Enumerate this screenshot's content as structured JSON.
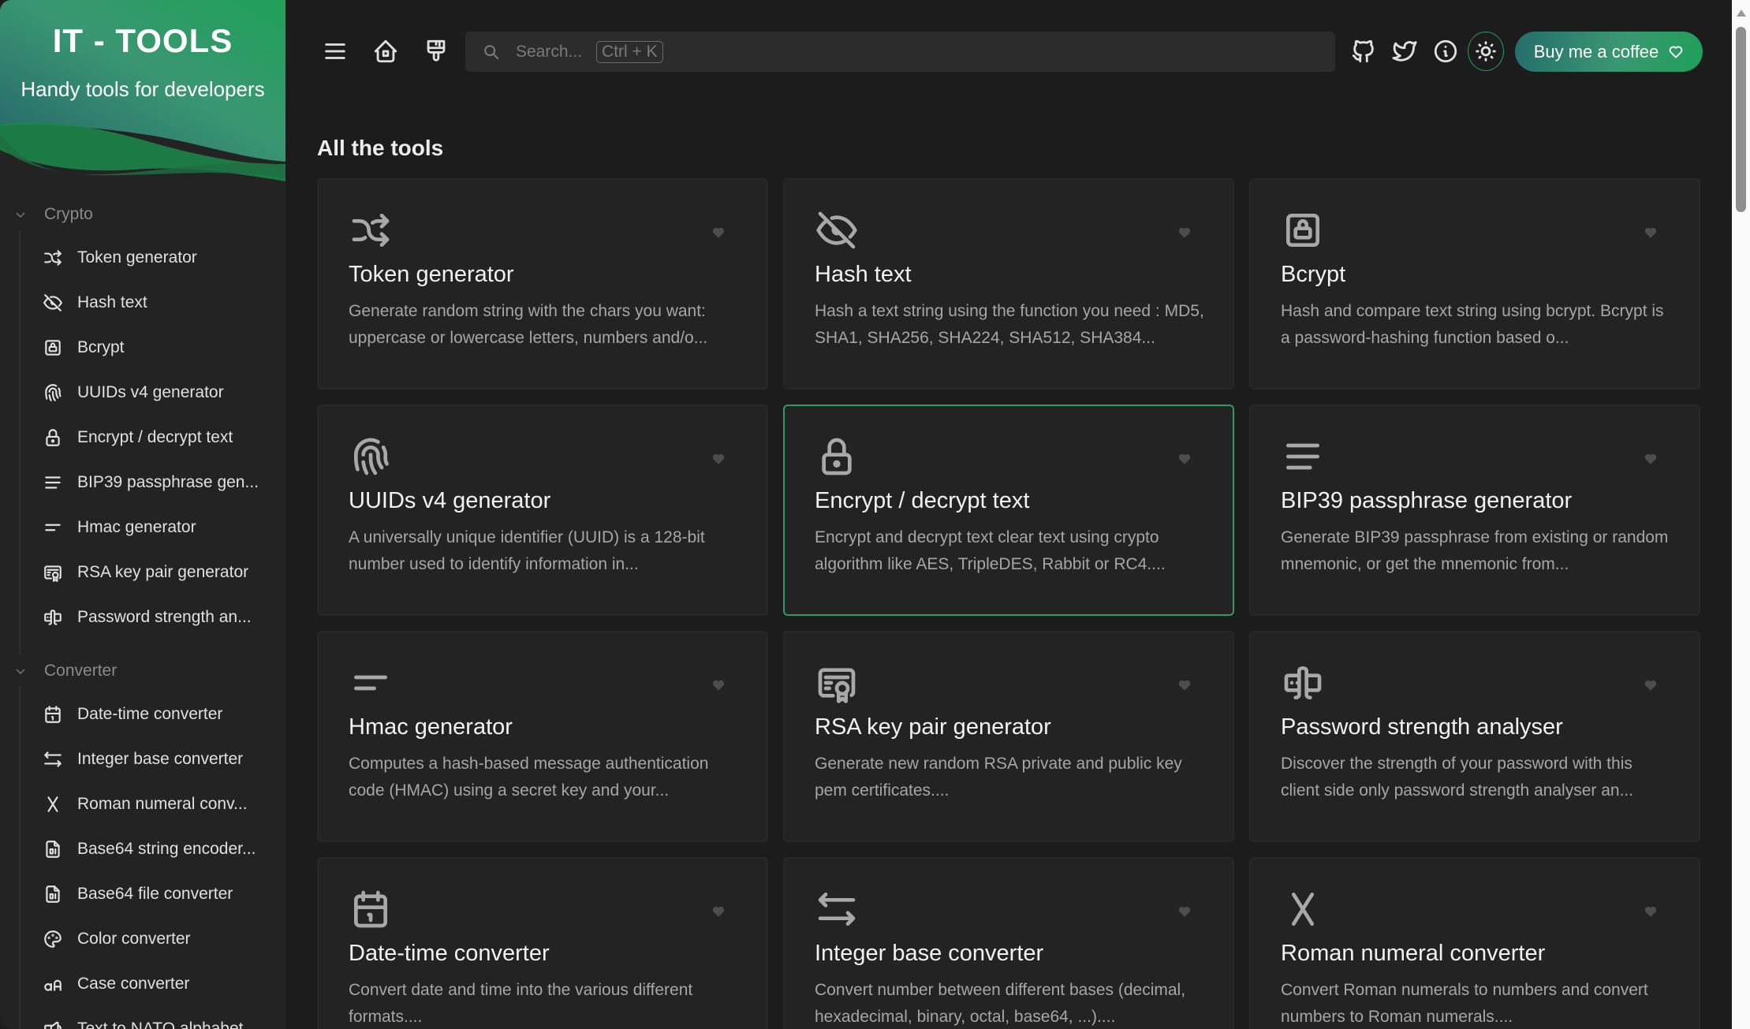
{
  "brand": {
    "title": "IT - TOOLS",
    "subtitle": "Handy tools for developers",
    "gradient_colors": [
      "#25636b",
      "#3a9772",
      "#1fa058"
    ]
  },
  "sidebar": {
    "groups": [
      {
        "label": "Crypto",
        "expanded": true,
        "items": [
          {
            "label": "Token generator",
            "icon": "shuffle-icon"
          },
          {
            "label": "Hash text",
            "icon": "eye-off-icon"
          },
          {
            "label": "Bcrypt",
            "icon": "lock-square-icon"
          },
          {
            "label": "UUIDs v4 generator",
            "icon": "fingerprint-icon"
          },
          {
            "label": "Encrypt / decrypt text",
            "icon": "lock-icon"
          },
          {
            "label": "BIP39 passphrase gen...",
            "icon": "align-justified-icon"
          },
          {
            "label": "Hmac generator",
            "icon": "short-text-icon"
          },
          {
            "label": "RSA key pair generator",
            "icon": "certificate-icon"
          },
          {
            "label": "Password strength an...",
            "icon": "password-field-icon"
          }
        ]
      },
      {
        "label": "Converter",
        "expanded": true,
        "items": [
          {
            "label": "Date-time converter",
            "icon": "calendar-icon"
          },
          {
            "label": "Integer base converter",
            "icon": "arrows-left-right-icon"
          },
          {
            "label": "Roman numeral conv...",
            "icon": "letter-x-icon"
          },
          {
            "label": "Base64 string encoder...",
            "icon": "file-binary-icon"
          },
          {
            "label": "Base64 file converter",
            "icon": "file-binary-icon"
          },
          {
            "label": "Color converter",
            "icon": "palette-icon"
          },
          {
            "label": "Case converter",
            "icon": "letter-case-icon"
          },
          {
            "label": "Text to NATO alphabet",
            "icon": "speakerphone-icon"
          }
        ]
      }
    ]
  },
  "topbar": {
    "search_placeholder": "Search...",
    "search_shortcut": "Ctrl + K",
    "coffee_label": "Buy me a coffee",
    "accent": "#1f9d55"
  },
  "main": {
    "heading": "All the tools",
    "tools": [
      {
        "title": "Token generator",
        "description": "Generate random string with the chars you want: uppercase or lowercase letters, numbers and/o...",
        "icon": "shuffle-icon",
        "active": false
      },
      {
        "title": "Hash text",
        "description": "Hash a text string using the function you need : MD5, SHA1, SHA256, SHA224, SHA512, SHA384...",
        "icon": "eye-off-icon",
        "active": false
      },
      {
        "title": "Bcrypt",
        "description": "Hash and compare text string using bcrypt. Bcrypt is a password-hashing function based o...",
        "icon": "lock-square-icon",
        "active": false
      },
      {
        "title": "UUIDs v4 generator",
        "description": "A universally unique identifier (UUID) is a 128-bit number used to identify information in...",
        "icon": "fingerprint-icon",
        "active": false
      },
      {
        "title": "Encrypt / decrypt text",
        "description": "Encrypt and decrypt text clear text using crypto algorithm like AES, TripleDES, Rabbit or RC4....",
        "icon": "lock-icon",
        "active": true
      },
      {
        "title": "BIP39 passphrase generator",
        "description": "Generate BIP39 passphrase from existing or random mnemonic, or get the mnemonic from...",
        "icon": "align-justified-icon",
        "active": false
      },
      {
        "title": "Hmac generator",
        "description": "Computes a hash-based message authentication code (HMAC) using a secret key and your...",
        "icon": "short-text-icon",
        "active": false
      },
      {
        "title": "RSA key pair generator",
        "description": "Generate new random RSA private and public key pem certificates....",
        "icon": "certificate-icon",
        "active": false
      },
      {
        "title": "Password strength analyser",
        "description": "Discover the strength of your password with this client side only password strength analyser an...",
        "icon": "password-field-icon",
        "active": false
      },
      {
        "title": "Date-time converter",
        "description": "Convert date and time into the various different formats....",
        "icon": "calendar-icon",
        "active": false
      },
      {
        "title": "Integer base converter",
        "description": "Convert number between different bases (decimal, hexadecimal, binary, octal, base64, ...)....",
        "icon": "arrows-left-right-icon",
        "active": false
      },
      {
        "title": "Roman numeral converter",
        "description": "Convert Roman numerals to numbers and convert numbers to Roman numerals....",
        "icon": "letter-x-icon",
        "active": false
      }
    ]
  }
}
